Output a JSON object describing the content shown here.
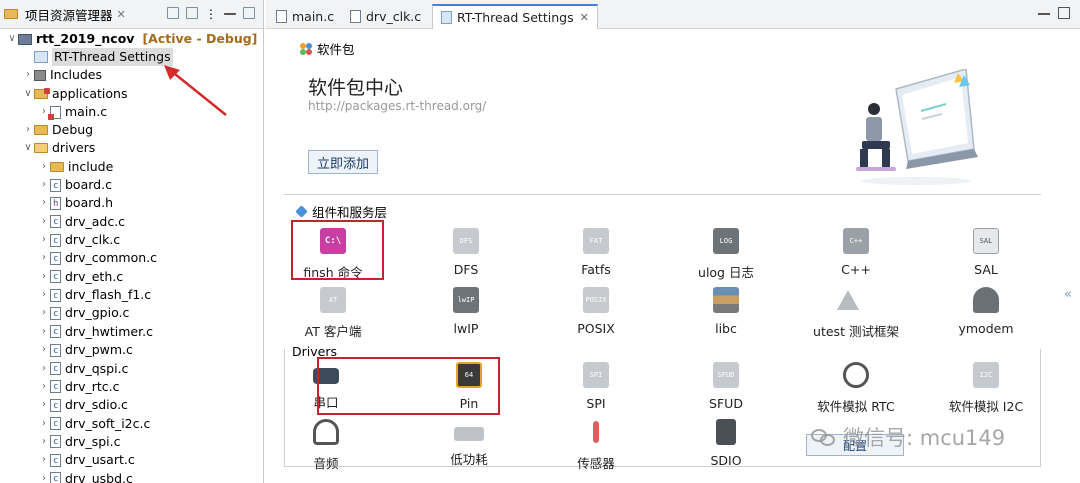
{
  "explorer": {
    "title": "项目资源管理器",
    "items": [
      {
        "label": "rtt_2019_ncov",
        "tag": "[Active - Debug]"
      },
      {
        "label": "RT-Thread Settings"
      },
      {
        "label": "Includes"
      },
      {
        "label": "applications"
      },
      {
        "label": "main.c"
      },
      {
        "label": "Debug"
      },
      {
        "label": "drivers"
      },
      {
        "label": "include"
      },
      {
        "label": "board.c"
      },
      {
        "label": "board.h"
      },
      {
        "label": "drv_adc.c"
      },
      {
        "label": "drv_clk.c"
      },
      {
        "label": "drv_common.c"
      },
      {
        "label": "drv_eth.c"
      },
      {
        "label": "drv_flash_f1.c"
      },
      {
        "label": "drv_gpio.c"
      },
      {
        "label": "drv_hwtimer.c"
      },
      {
        "label": "drv_pwm.c"
      },
      {
        "label": "drv_qspi.c"
      },
      {
        "label": "drv_rtc.c"
      },
      {
        "label": "drv_sdio.c"
      },
      {
        "label": "drv_soft_i2c.c"
      },
      {
        "label": "drv_spi.c"
      },
      {
        "label": "drv_usart.c"
      },
      {
        "label": "drv_usbd.c"
      }
    ]
  },
  "tabs": [
    {
      "label": "main.c"
    },
    {
      "label": "drv_clk.c"
    },
    {
      "label": "RT-Thread Settings"
    }
  ],
  "main": {
    "pkg_header": "软件包",
    "center_title": "软件包中心",
    "center_url": "http://packages.rt-thread.org/",
    "add_button": "立即添加",
    "components_title": "组件和服务层",
    "drivers_title": "Drivers",
    "config_button": "配置",
    "watermark": "微信号: mcu149"
  },
  "components_row1": [
    {
      "label": "finsh 命令",
      "icon": "C:\\"
    },
    {
      "label": "DFS",
      "icon": "DFS"
    },
    {
      "label": "Fatfs",
      "icon": "FAT"
    },
    {
      "label": "ulog 日志",
      "icon": "LOG"
    },
    {
      "label": "C++",
      "icon": "C++"
    },
    {
      "label": "SAL",
      "icon": "SAL"
    }
  ],
  "components_row2": [
    {
      "label": "AT 客户端",
      "icon": "AT"
    },
    {
      "label": "lwIP",
      "icon": "lwIP"
    },
    {
      "label": "POSIX",
      "icon": "POSIX"
    },
    {
      "label": "libc",
      "icon": "books-icon"
    },
    {
      "label": "utest 测试框架",
      "icon": "TEST"
    },
    {
      "label": "ymodem",
      "icon": "phone-icon"
    }
  ],
  "drivers_row1": [
    {
      "label": "串口",
      "icon": "serial-port-icon"
    },
    {
      "label": "Pin",
      "icon": "64"
    },
    {
      "label": "SPI",
      "icon": "SPI"
    },
    {
      "label": "SFUD",
      "icon": "SFUD"
    },
    {
      "label": "软件模拟 RTC",
      "icon": "clock-icon"
    },
    {
      "label": "软件模拟 I2C",
      "icon": "I2C"
    }
  ],
  "drivers_row2": [
    {
      "label": "音频",
      "icon": "headset-icon"
    },
    {
      "label": "低功耗",
      "icon": "battery-icon"
    },
    {
      "label": "传感器",
      "icon": "thermometer-icon"
    },
    {
      "label": "SDIO",
      "icon": "sd-card-icon"
    }
  ]
}
